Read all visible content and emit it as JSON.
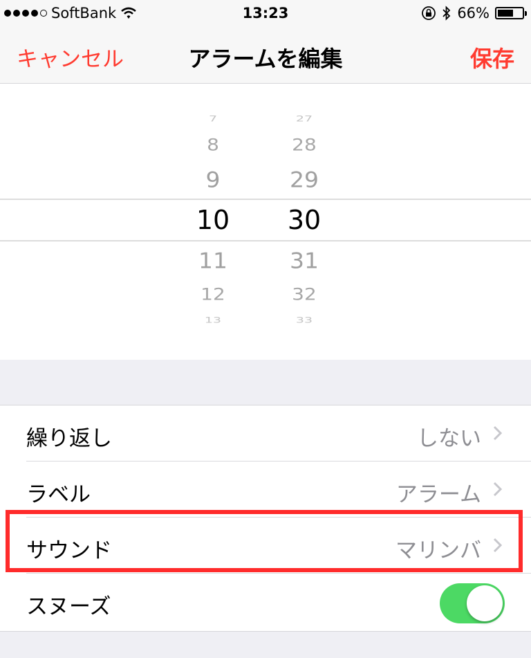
{
  "status_bar": {
    "carrier": "SoftBank",
    "time": "13:23",
    "battery_percent": "66%",
    "battery_level": 0.66,
    "signal_icon": "signal-dots-icon",
    "wifi_icon": "wifi-icon",
    "orientation_lock_icon": "orientation-lock-icon",
    "bluetooth_icon": "bluetooth-icon"
  },
  "nav": {
    "cancel_label": "キャンセル",
    "title": "アラームを編集",
    "save_label": "保存",
    "accent_color": "#ff3b30"
  },
  "picker": {
    "hours": [
      "7",
      "8",
      "9",
      "10",
      "11",
      "12",
      "13"
    ],
    "minutes": [
      "27",
      "28",
      "29",
      "30",
      "31",
      "32",
      "33"
    ],
    "selected_hour": "10",
    "selected_minute": "30"
  },
  "settings": {
    "repeat": {
      "label": "繰り返し",
      "value": "しない"
    },
    "label": {
      "label": "ラベル",
      "value": "アラーム"
    },
    "sound": {
      "label": "サウンド",
      "value": "マリンバ"
    },
    "snooze": {
      "label": "スヌーズ",
      "enabled": true,
      "toggle_color": "#4cd964"
    }
  },
  "highlight_color": "#ff2b2b"
}
